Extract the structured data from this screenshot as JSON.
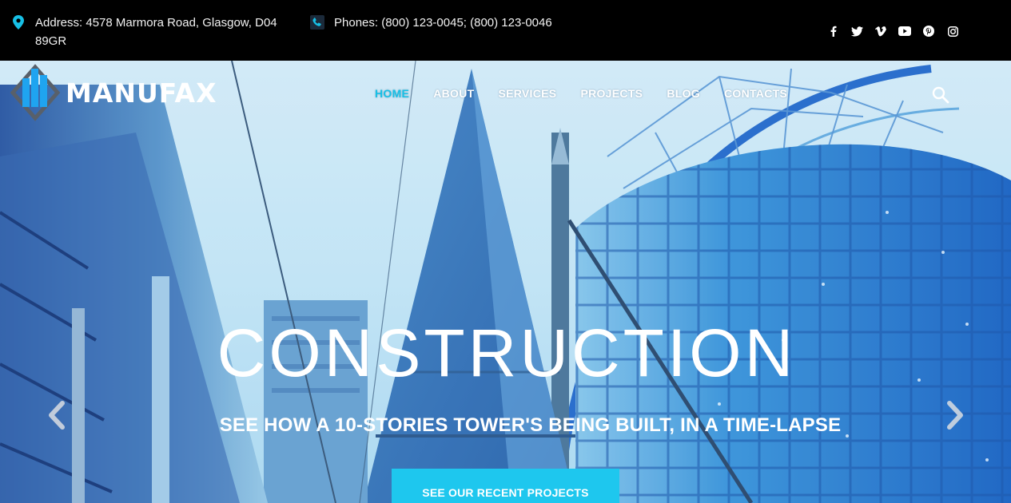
{
  "topbar": {
    "address": "Address: 4578 Marmora Road, Glasgow, D04 89GR",
    "phones": "Phones: (800) 123-0045; (800) 123-0046",
    "accent_color": "#17c0e6",
    "social": [
      {
        "name": "facebook-icon"
      },
      {
        "name": "twitter-icon"
      },
      {
        "name": "vimeo-icon"
      },
      {
        "name": "youtube-icon"
      },
      {
        "name": "pinterest-icon"
      },
      {
        "name": "instagram-icon"
      }
    ]
  },
  "header": {
    "logo_text": "MANUFAX",
    "nav": {
      "home": "HOME",
      "about": "ABOUT",
      "services": "SERVICES",
      "projects": "PROJECTS",
      "blog": "BLOG",
      "contacts": "CONTACTS"
    },
    "active_nav": "HOME",
    "search_icon": "search-icon"
  },
  "slide": {
    "title": "CONSTRUCTION",
    "subtitle": "SEE HOW A 10-STORIES TOWER'S BEING BUILT, IN A TIME-LAPSE",
    "cta_label": "SEE OUR RECENT PROJECTS",
    "cta_color": "#1ec7ee",
    "prev_icon": "chevron-left-icon",
    "next_icon": "chevron-right-icon"
  }
}
